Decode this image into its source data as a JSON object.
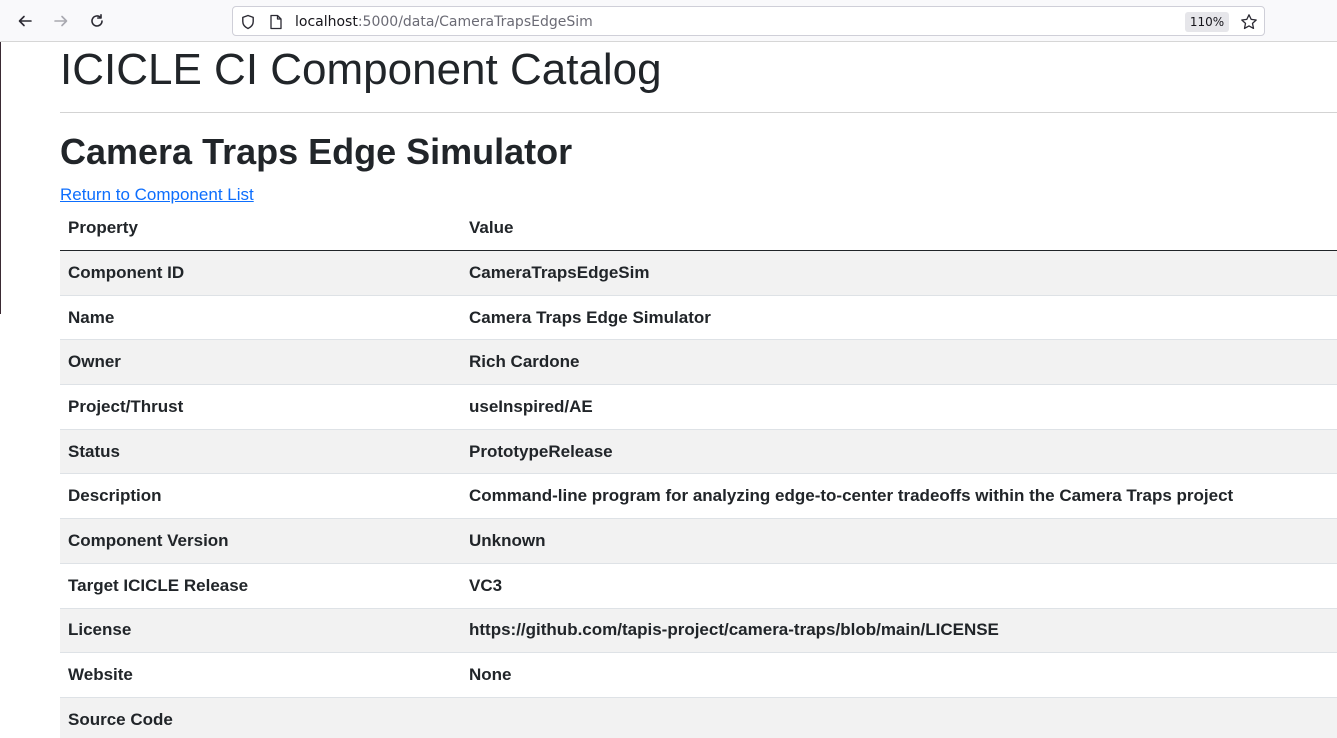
{
  "browser": {
    "url_host": "localhost",
    "url_path": ":5000/data/CameraTrapsEdgeSim",
    "zoom": "110%"
  },
  "page": {
    "title": "ICICLE CI Component Catalog",
    "component_title": "Camera Traps Edge Simulator",
    "return_link": "Return to Component List"
  },
  "table": {
    "headers": {
      "property": "Property",
      "value": "Value"
    },
    "rows": [
      {
        "property": "Component ID",
        "value": "CameraTrapsEdgeSim"
      },
      {
        "property": "Name",
        "value": "Camera Traps Edge Simulator"
      },
      {
        "property": "Owner",
        "value": "Rich Cardone"
      },
      {
        "property": "Project/Thrust",
        "value": "useInspired/AE"
      },
      {
        "property": "Status",
        "value": "PrototypeRelease"
      },
      {
        "property": "Description",
        "value": "Command-line program for analyzing edge-to-center tradeoffs within the Camera Traps project"
      },
      {
        "property": "Component Version",
        "value": "Unknown"
      },
      {
        "property": "Target ICICLE Release",
        "value": "VC3"
      },
      {
        "property": "License",
        "value": "https://github.com/tapis-project/camera-traps/blob/main/LICENSE"
      },
      {
        "property": "Website",
        "value": "None"
      },
      {
        "property": "Source Code",
        "value": ""
      }
    ]
  },
  "colors": {
    "link": "#0d6efd",
    "stripe": "#f2f2f2",
    "text": "#212529"
  }
}
